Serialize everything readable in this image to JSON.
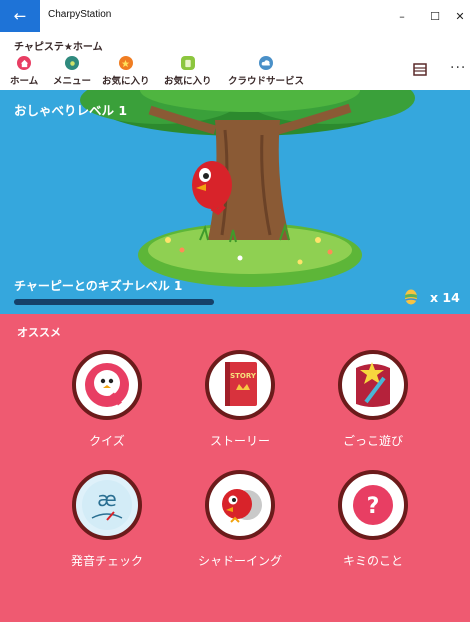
{
  "window": {
    "title": "CharpyStation",
    "back_icon": "←",
    "minimize": "–",
    "maximize": "☐",
    "close": "✕"
  },
  "header": {
    "page_title": "チャピステ★ホーム",
    "nav": [
      {
        "label": "ホーム",
        "icon": "home-icon",
        "color": "#e83e63"
      },
      {
        "label": "メニュー",
        "icon": "menu-icon",
        "color": "#2f8a7e"
      },
      {
        "label": "お気に入り",
        "icon": "star-icon",
        "color": "#f07d22"
      },
      {
        "label": "お気に入り",
        "icon": "favorite-icon",
        "color": "#8cc63e"
      },
      {
        "label": "クラウドサービス",
        "icon": "cloud-icon",
        "color": "#4a90c8"
      }
    ],
    "more": "···"
  },
  "hero": {
    "chat_level": "おしゃべりレベル 1",
    "bond_level": "チャーピーとのキズナレベル 1",
    "bond_progress": 1.0,
    "egg_count": "x 14"
  },
  "recommend": {
    "title": "オススメ",
    "items": [
      {
        "label": "クイズ",
        "icon": "quiz-icon"
      },
      {
        "label": "ストーリー",
        "icon": "story-book-icon",
        "book_text": "STORY"
      },
      {
        "label": "ごっこ遊び",
        "icon": "pretend-play-icon"
      },
      {
        "label": "発音チェック",
        "icon": "pronunciation-icon",
        "glyph": "æ"
      },
      {
        "label": "シャドーイング",
        "icon": "shadowing-icon"
      },
      {
        "label": "キミのこと",
        "icon": "about-you-icon",
        "glyph": "?"
      }
    ]
  }
}
